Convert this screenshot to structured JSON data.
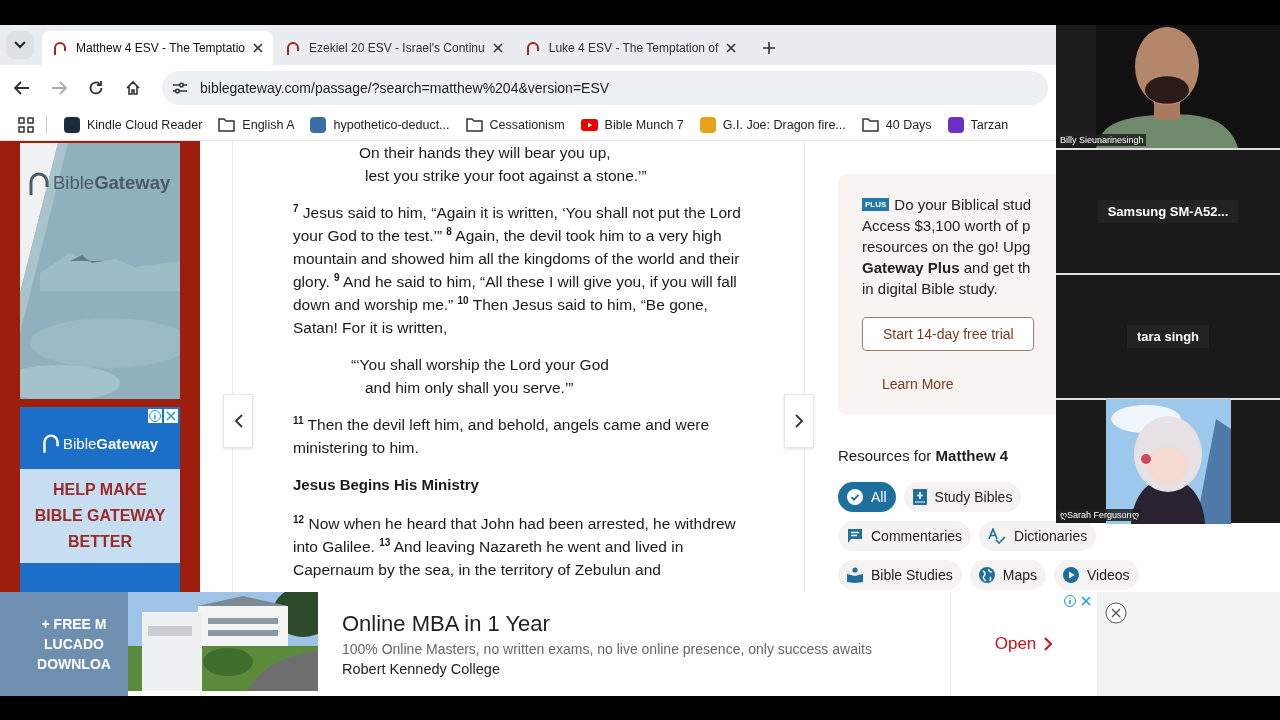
{
  "browser": {
    "tabs": [
      {
        "title": "Matthew 4 ESV - The Temptatio",
        "selected": true
      },
      {
        "title": "Ezekiel 20 ESV - Israel's Continu",
        "selected": false
      },
      {
        "title": "Luke 4 ESV - The Temptation of",
        "selected": false
      }
    ],
    "url": "biblegateway.com/passage/?search=matthew%204&version=ESV",
    "bookmarks": [
      {
        "label": "Kindle Cloud Reader",
        "kind": "site",
        "color": "#1b2a3a"
      },
      {
        "label": "English A",
        "kind": "folder"
      },
      {
        "label": "hypothetico-deduct...",
        "kind": "site",
        "color": "#3a6ea8"
      },
      {
        "label": "Cessationism",
        "kind": "folder"
      },
      {
        "label": "Bible Munch 7",
        "kind": "video"
      },
      {
        "label": "G.I. Joe: Dragon fire...",
        "kind": "site",
        "color": "#e8a21c"
      },
      {
        "label": "40 Days",
        "kind": "folder"
      },
      {
        "label": "Tarzan",
        "kind": "site",
        "color": "#6b2fc4"
      }
    ]
  },
  "left_ads": {
    "top_logo": "Bible**Gateway**",
    "banner_logo": "Bible**Gateway**",
    "banner_headline": "HELP MAKE BIBLE GATEWAY BETTER",
    "faded_lines": [
      "+ FREE M",
      "LUCADO",
      "DOWNLOA"
    ]
  },
  "passage": [
    {
      "kind": "poetry",
      "lines": [
        "On their hands they will bear you up,",
        "lest you strike your foot against a stone.’”"
      ]
    },
    {
      "kind": "prose",
      "text": "$^{7}$ Jesus said to him, “Again it is written, ‘You shall not put the Lord your God to the test.’” $^{8}$ Again, the devil took him to a very high mountain and showed him all the kingdoms of the world and their glory. $^{9}$ And he said to him, “All these I will give you, if you will fall down and worship me.” $^{10}$ Then Jesus said to him, “Be gone, Satan! For it is written,"
    },
    {
      "kind": "poetry",
      "lines": [
        "“‘You shall worship the Lord your God",
        "and him only shall you serve.’”"
      ]
    },
    {
      "kind": "prose",
      "text": "$^{11}$ Then the devil left him, and behold, angels came and were ministering to him."
    },
    {
      "kind": "heading",
      "text": "Jesus Begins His Ministry"
    },
    {
      "kind": "prose",
      "text": "$^{12}$ Now when he heard that John had been arrested, he withdrew into Galilee. $^{13}$ And leaving Nazareth he went and lived in Capernaum by the sea, in the territory of Zebulun and"
    }
  ],
  "plus_promo": {
    "badge": "PLUS",
    "lines": [
      "Do your Biblical stud",
      "Access $3,100 worth of p",
      "resources on the go! Upg",
      "**Gateway Plus** and get th",
      "in digital Bible study."
    ],
    "trial_button": "Start 14-day free trial",
    "learn_more": "Learn More"
  },
  "resources": {
    "heading": "Resources for **Matthew 4**",
    "chip_rows": [
      [
        {
          "label": "All",
          "kind": "check",
          "selected": true
        },
        {
          "label": "Study Bibles",
          "kind": "book",
          "selected": false
        }
      ],
      [
        {
          "label": "Commentaries",
          "kind": "comment",
          "selected": false
        },
        {
          "label": "Dictionaries",
          "kind": "dictionary",
          "selected": false
        }
      ],
      [
        {
          "label": "Bible Studies",
          "kind": "reader",
          "selected": false
        },
        {
          "label": "Maps",
          "kind": "globe",
          "selected": false
        },
        {
          "label": "Videos",
          "kind": "play",
          "selected": false
        }
      ]
    ]
  },
  "bottom_ad": {
    "title": "Online MBA in 1 Year",
    "description": "100% Online Masters, no written exams, no live online presence, only success awaits",
    "sponsor": "Robert Kennedy College",
    "action": "Open"
  },
  "participants": [
    {
      "name": "Billy Sieunarinesingh",
      "kind": "video"
    },
    {
      "name": "Samsung  SM-A52...",
      "kind": "name"
    },
    {
      "name": "tara singh",
      "kind": "name"
    },
    {
      "name": "ღSarah Fergusonღ",
      "kind": "picture"
    }
  ]
}
